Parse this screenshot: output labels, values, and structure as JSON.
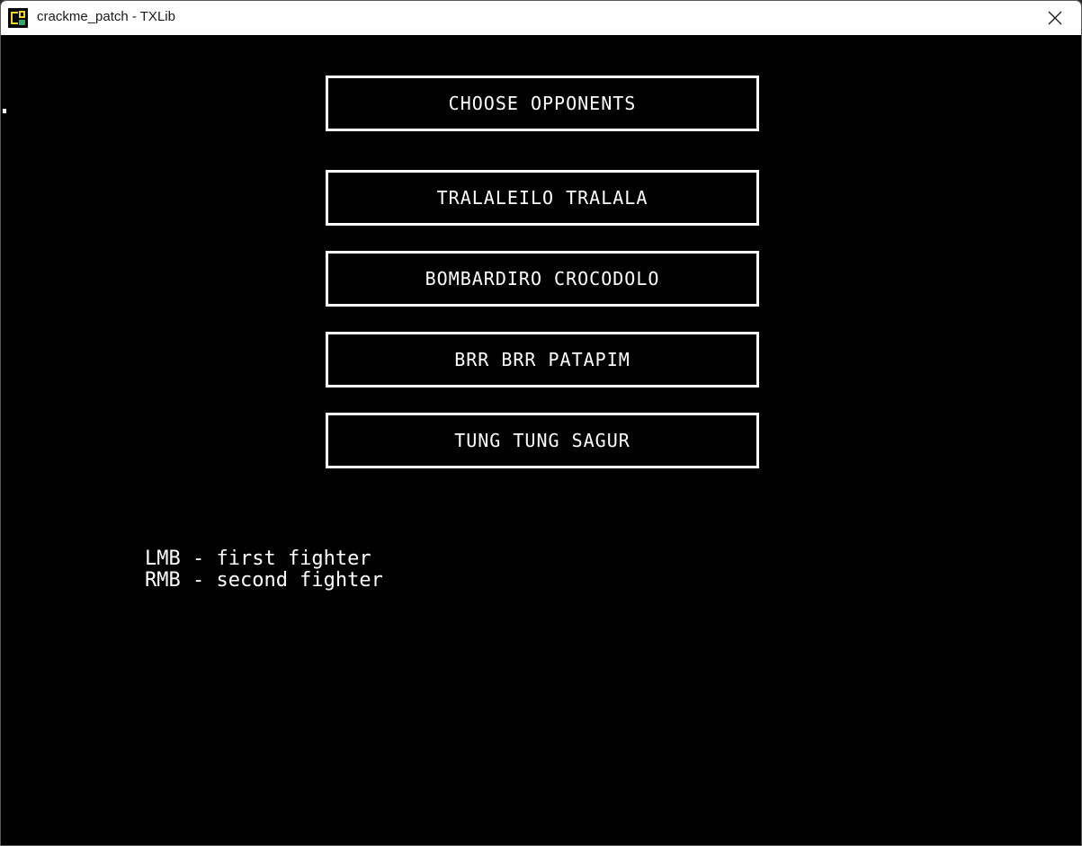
{
  "window": {
    "title": "crackme_patch - TXLib",
    "icon": "txlib-app-icon",
    "close_icon": "close-icon"
  },
  "menu": {
    "header": "CHOOSE OPPONENTS",
    "fighters": [
      "TRALALEILO TRALALA",
      "BOMBARDIRO CROCODOLO",
      "BRR BRR PATAPIM",
      "TUNG TUNG SAGUR"
    ]
  },
  "hints": {
    "lmb": "LMB - first fighter",
    "rmb": "RMB - second fighter"
  },
  "colors": {
    "background": "#000000",
    "foreground": "#ffffff",
    "titlebar": "#ffffff"
  }
}
